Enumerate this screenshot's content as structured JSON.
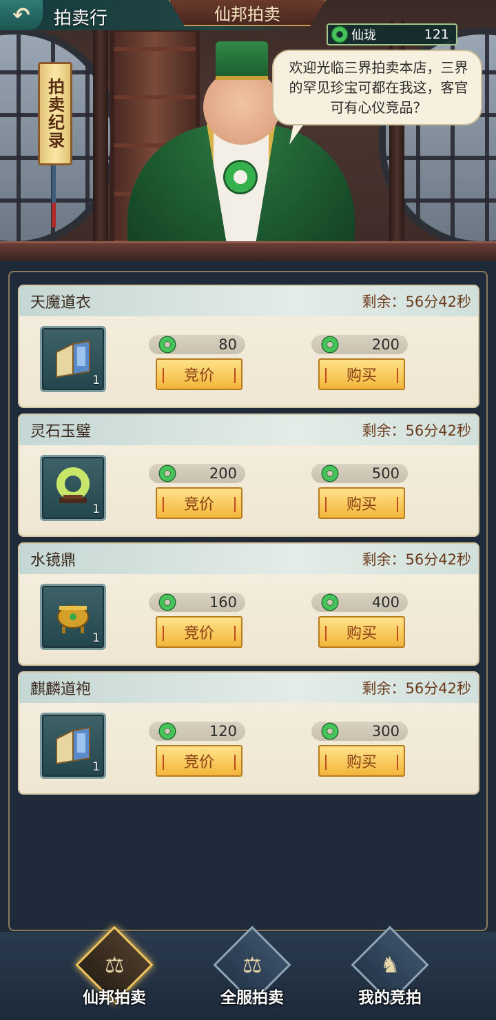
{
  "header": {
    "back_icon": "back-arrow-icon",
    "page_title": "拍卖行",
    "section_title": "仙邦拍卖"
  },
  "currency": {
    "icon": "jade-ring-icon",
    "name": "仙珑",
    "amount": "121"
  },
  "record_button": {
    "label": "拍卖纪录"
  },
  "speech": {
    "text": "欢迎光临三界拍卖本店，三界的罕见珍宝可都在我这，客官可有心仪竞品？"
  },
  "items": [
    {
      "name": "天魔道衣",
      "timer": "剩余：56分42秒",
      "icon": "scroll-book-icon",
      "qty": "1",
      "bid_price": "80",
      "buy_price": "200",
      "bid_label": "竞价",
      "buy_label": "购买"
    },
    {
      "name": "灵石玉璧",
      "timer": "剩余：56分42秒",
      "icon": "jade-disc-icon",
      "qty": "1",
      "bid_price": "200",
      "buy_price": "500",
      "bid_label": "竞价",
      "buy_label": "购买"
    },
    {
      "name": "水镜鼎",
      "timer": "剩余：56分42秒",
      "icon": "golden-cauldron-icon",
      "qty": "1",
      "bid_price": "160",
      "buy_price": "400",
      "bid_label": "竞价",
      "buy_label": "购买"
    },
    {
      "name": "麒麟道袍",
      "timer": "剩余：56分42秒",
      "icon": "scroll-book-icon",
      "qty": "1",
      "bid_price": "120",
      "buy_price": "300",
      "bid_label": "竞价",
      "buy_label": "购买"
    }
  ],
  "nav": [
    {
      "label": "仙邦拍卖",
      "icon": "gavel-icon",
      "active": true
    },
    {
      "label": "全服拍卖",
      "icon": "scales-icon",
      "active": false
    },
    {
      "label": "我的竞拍",
      "icon": "bid-bag-icon",
      "active": false
    }
  ],
  "colors": {
    "accent_gold": "#f3b63a",
    "jade_green": "#46c45a",
    "panel_bg": "#1f2b3a"
  }
}
